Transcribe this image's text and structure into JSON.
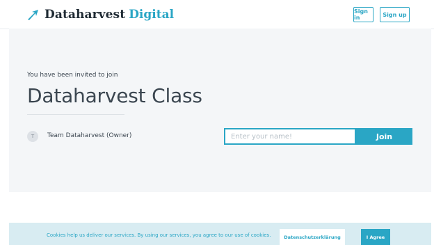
{
  "header": {
    "brand_name": "Dataharvest",
    "brand_accent": "Digital",
    "logo_icon": "arrow-up-right-icon",
    "sign_in_label": "Sign in",
    "sign_up_label": "Sign up"
  },
  "invite": {
    "intro": "You have been invited to join",
    "class_name": "Dataharvest Class",
    "owner_initial": "T",
    "owner_label": "Team Dataharvest (Owner)",
    "name_placeholder": "Enter your name!",
    "name_value": "",
    "join_label": "Join"
  },
  "cookies": {
    "message": "Cookies help us deliver our services. By using our services, you agree to our use of cookies.",
    "privacy_label": "Datenschutzerklärung",
    "agree_label": "I Agree"
  },
  "colors": {
    "accent": "#2aa6c5",
    "panel_bg": "#f4f6f8",
    "cookie_bg": "#d8ecf2",
    "text": "#3b4650"
  }
}
